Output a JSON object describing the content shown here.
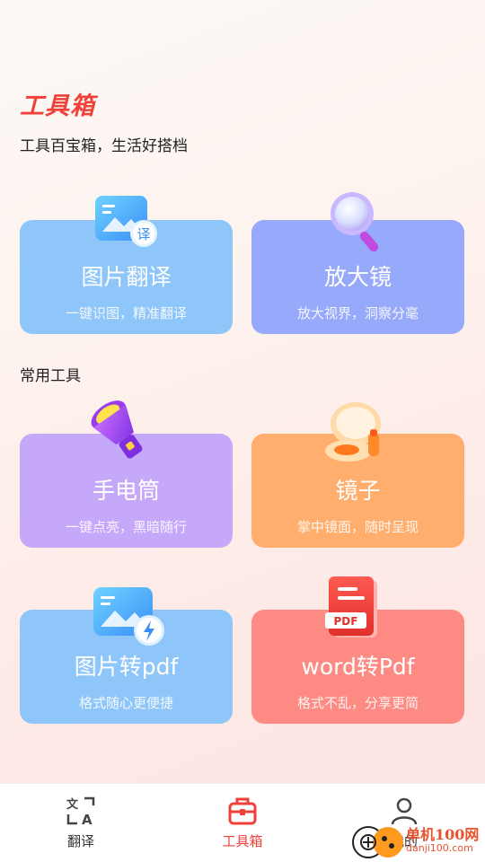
{
  "header": {
    "title": "工具箱",
    "subtitle": "工具百宝箱，生活好搭档"
  },
  "section": {
    "common_tools": "常用工具"
  },
  "cards": {
    "translate": {
      "title": "图片翻译",
      "desc": "一键识图，精准翻译",
      "badge": "译",
      "color": "#8fc6f9"
    },
    "magnifier": {
      "title": "放大镜",
      "desc": "放大视界，洞察分毫",
      "color": "#97a9fb"
    },
    "flashlight": {
      "title": "手电筒",
      "desc": "一键点亮，黑暗随行",
      "color": "#c6a8fb"
    },
    "mirror": {
      "title": "镜子",
      "desc": "掌中镜面，随时呈现",
      "color": "#ffae6d"
    },
    "img2pdf": {
      "title": "图片转pdf",
      "desc": "格式随心更便捷",
      "color": "#8fc6f9"
    },
    "word2pdf": {
      "title": "word转Pdf",
      "desc": "格式不乱，分享更简",
      "badge": "PDF",
      "color": "#fd8b84"
    }
  },
  "nav": {
    "items": [
      {
        "label": "翻译",
        "icon": "translate-icon",
        "active": false
      },
      {
        "label": "工具箱",
        "icon": "toolbox-icon",
        "active": true
      },
      {
        "label": "我的",
        "icon": "user-icon",
        "active": false
      }
    ],
    "active_color": "#f0403a"
  },
  "watermark": {
    "line1": "单机100网",
    "line2": "danji100.com"
  }
}
